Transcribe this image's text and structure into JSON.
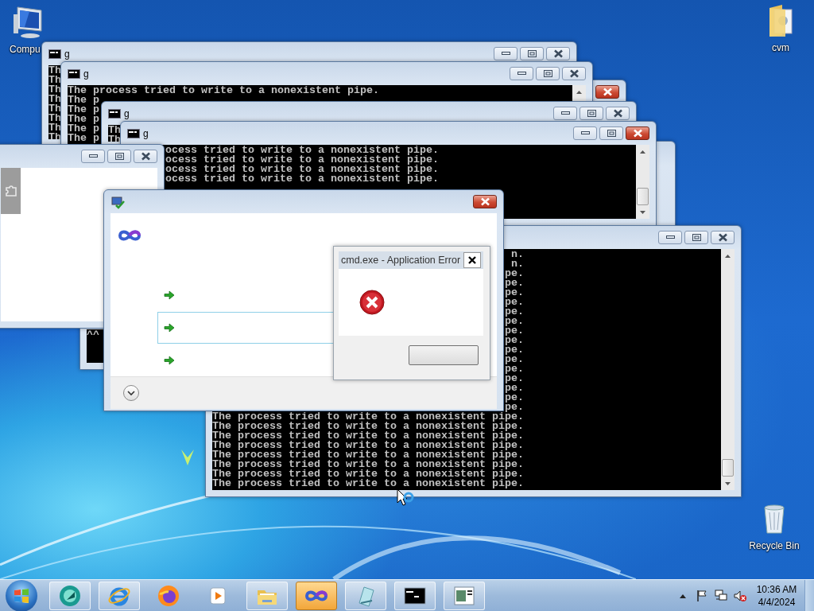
{
  "desktop_icons": [
    {
      "kind": "computer",
      "label": "Compu"
    },
    {
      "kind": "folder",
      "label": "cvm"
    },
    {
      "kind": "recycle-bin",
      "label": "Recycle Bin"
    }
  ],
  "windows": [
    {
      "kind": "console",
      "title": "g",
      "active": false,
      "lines": [
        "Th",
        "Th",
        "Th",
        "Th",
        "Th",
        "Th",
        "Th",
        "Th"
      ]
    },
    {
      "kind": "frame",
      "active": true
    },
    {
      "kind": "console",
      "title": "g",
      "active": false,
      "lines": [
        "The process tried to write to a nonexistent pipe.",
        "The p",
        "The p",
        "The p",
        "The p",
        "The p"
      ]
    },
    {
      "kind": "console",
      "title": "g",
      "active": false,
      "lines": [
        "Th",
        "Th"
      ]
    },
    {
      "kind": "frame"
    },
    {
      "kind": "console-tail",
      "title": "g",
      "active": true,
      "lines": [
        "ocess tried to write to a nonexistent pipe.",
        "ocess tried to write to a nonexistent pipe.",
        "ocess tried to write to a nonexistent pipe.",
        "ocess tried to write to a nonexistent pipe."
      ]
    },
    {
      "kind": "console",
      "lines": [
        "^^"
      ]
    },
    {
      "kind": "blank",
      "active": false
    },
    {
      "kind": "console-tail",
      "active": false,
      "lines": [
        "n.",
        "n.",
        "pe.",
        "pe.",
        "pe.",
        "pe.",
        "pe.",
        "pe.",
        "pe.",
        "pe.",
        "pe.",
        "pe.",
        "pe.",
        "pe.",
        "pe.",
        "pe.",
        "pe.",
        "The process tried to write to a nonexistent pipe.",
        "The process tried to write to a nonexistent pipe.",
        "The process tried to write to a nonexistent pipe.",
        "The process tried to write to a nonexistent pipe.",
        "The process tried to write to a nonexistent pipe.",
        "The process tried to write to a nonexistent pipe.",
        "The process tried to write to a nonexistent pipe.",
        "The process tried to write to a nonexistent pipe."
      ]
    },
    {
      "kind": "setup",
      "active": true,
      "options": [
        {
          "selected": false
        },
        {
          "selected": true
        },
        {
          "selected": false
        }
      ]
    },
    {
      "kind": "error",
      "title": "cmd.exe - Application Error"
    }
  ],
  "taskbar": {
    "items": [
      {
        "kind": "chat",
        "running": true,
        "flashing": false
      },
      {
        "kind": "ie",
        "running": true,
        "flashing": false
      },
      {
        "kind": "firefox",
        "running": false,
        "flashing": false
      },
      {
        "kind": "player",
        "running": false,
        "flashing": false
      },
      {
        "kind": "explorer",
        "running": true,
        "flashing": false
      },
      {
        "kind": "infinity",
        "running": true,
        "flashing": true
      },
      {
        "kind": "notepad",
        "running": true,
        "flashing": false
      },
      {
        "kind": "console",
        "running": true,
        "flashing": false
      },
      {
        "kind": "window",
        "running": true,
        "flashing": false
      }
    ],
    "clock": {
      "time": "10:36 AM",
      "date": "4/4/2024"
    }
  }
}
